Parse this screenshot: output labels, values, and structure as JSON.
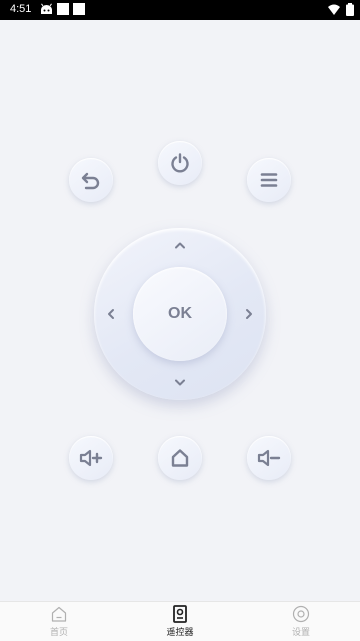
{
  "status_bar": {
    "time": "4:51"
  },
  "remote": {
    "ok_label": "OK",
    "buttons": {
      "back": "back-icon",
      "power": "power-icon",
      "menu": "menu-icon",
      "volume_up": "volume-up-icon",
      "home": "home-icon",
      "volume_down": "volume-down-icon"
    }
  },
  "tabbar": {
    "tabs": [
      {
        "label": "首页",
        "icon": "home-icon",
        "active": false
      },
      {
        "label": "遥控器",
        "icon": "remote-icon",
        "active": true
      },
      {
        "label": "设置",
        "icon": "settings-icon",
        "active": false
      }
    ]
  },
  "colors": {
    "icon": "#7b8093",
    "tab_active": "#222222",
    "tab_inactive": "#b0b0b0"
  }
}
